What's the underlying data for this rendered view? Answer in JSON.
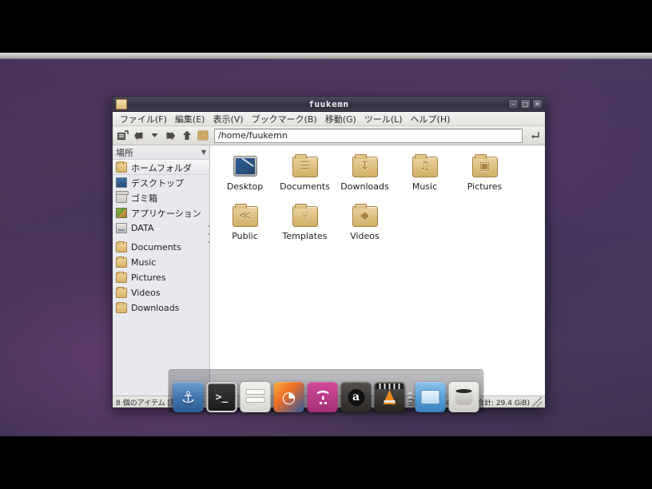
{
  "window": {
    "title": "fuukemn",
    "icon": "folder-icon",
    "buttons": [
      {
        "name": "minimize-button",
        "label": "–"
      },
      {
        "name": "maximize-button",
        "label": "□"
      },
      {
        "name": "close-button",
        "label": "✕"
      }
    ]
  },
  "menubar": {
    "items": [
      {
        "name": "menu-file",
        "label": "ファイル(F)"
      },
      {
        "name": "menu-edit",
        "label": "編集(E)"
      },
      {
        "name": "menu-view",
        "label": "表示(V)"
      },
      {
        "name": "menu-bookmarks",
        "label": "ブックマーク(B)"
      },
      {
        "name": "menu-go",
        "label": "移動(G)"
      },
      {
        "name": "menu-tools",
        "label": "ツール(L)"
      },
      {
        "name": "menu-help",
        "label": "ヘルプ(H)"
      }
    ]
  },
  "toolbar": {
    "buttons": [
      {
        "name": "new-tab-icon",
        "glyph": "❐"
      },
      {
        "name": "back-icon",
        "glyph": "⬅"
      },
      {
        "name": "history-dropdown-icon",
        "glyph": "▾"
      },
      {
        "name": "forward-icon",
        "glyph": "➡"
      },
      {
        "name": "up-icon",
        "glyph": "⬆"
      },
      {
        "name": "home-icon",
        "glyph": "■"
      }
    ],
    "path_value": "/home/fuukemn",
    "path_placeholder": "/home/fuukemn",
    "go_glyph": "↵"
  },
  "sidebar": {
    "header": "場所",
    "header_caret": "▼",
    "items": [
      {
        "name": "sidebar-item-home",
        "label": "ホームフォルダ",
        "icon": "ic-folder",
        "selected": true
      },
      {
        "name": "sidebar-item-desktop",
        "label": "デスクトップ",
        "icon": "ic-desktop",
        "selected": false
      },
      {
        "name": "sidebar-item-trash",
        "label": "ゴミ箱",
        "icon": "ic-trash",
        "selected": false
      },
      {
        "name": "sidebar-item-applications",
        "label": "アプリケーション",
        "icon": "ic-apps",
        "selected": false
      },
      {
        "name": "sidebar-item-data",
        "label": "DATA",
        "icon": "ic-drive",
        "selected": false
      },
      {
        "name": "sidebar-item-documents",
        "label": "Documents",
        "icon": "ic-folder",
        "selected": false,
        "gap_before": true
      },
      {
        "name": "sidebar-item-music",
        "label": "Music",
        "icon": "ic-folder",
        "selected": false
      },
      {
        "name": "sidebar-item-pictures",
        "label": "Pictures",
        "icon": "ic-folder",
        "selected": false
      },
      {
        "name": "sidebar-item-videos",
        "label": "Videos",
        "icon": "ic-folder",
        "selected": false
      },
      {
        "name": "sidebar-item-downloads",
        "label": "Downloads",
        "icon": "ic-folder",
        "selected": false
      }
    ]
  },
  "files": [
    {
      "name": "file-item-desktop",
      "label": "Desktop",
      "icon": "desktop-monitor-icon",
      "glyph": ""
    },
    {
      "name": "file-item-documents",
      "label": "Documents",
      "icon": "folder-documents-icon",
      "glyph": "☰"
    },
    {
      "name": "file-item-downloads",
      "label": "Downloads",
      "icon": "folder-downloads-icon",
      "glyph": "↧"
    },
    {
      "name": "file-item-music",
      "label": "Music",
      "icon": "folder-music-icon",
      "glyph": "♫"
    },
    {
      "name": "file-item-pictures",
      "label": "Pictures",
      "icon": "folder-pictures-icon",
      "glyph": "▣"
    },
    {
      "name": "file-item-public",
      "label": "Public",
      "icon": "folder-public-icon",
      "glyph": "≪"
    },
    {
      "name": "file-item-templates",
      "label": "Templates",
      "icon": "folder-templates-icon",
      "glyph": "⑂"
    },
    {
      "name": "file-item-videos",
      "label": "Videos",
      "icon": "folder-videos-icon",
      "glyph": "◆"
    }
  ],
  "statusbar": {
    "left": "8 個のアイテム [隠しアイテム 21個]",
    "right": "空き容量: 24.4 GiB (合計: 29.4 GiB)"
  },
  "dock": {
    "items": [
      {
        "name": "dock-item-docky",
        "cls": "d-docky",
        "glyph": "⚓"
      },
      {
        "name": "dock-item-terminal",
        "cls": "d-term",
        "glyph": ">_"
      },
      {
        "name": "dock-item-files",
        "cls": "d-files",
        "glyph": ""
      },
      {
        "name": "dock-item-firefox",
        "cls": "d-firefox",
        "glyph": "◔"
      },
      {
        "name": "dock-item-messaging",
        "cls": "d-chat",
        "glyph": ":-)"
      },
      {
        "name": "dock-item-amazon",
        "cls": "d-amazon",
        "glyph": "a"
      },
      {
        "name": "dock-item-vlc",
        "cls": "d-vlc",
        "glyph": ""
      },
      {
        "name": "dock-item-display",
        "cls": "d-display",
        "glyph": ""
      },
      {
        "name": "dock-item-trash",
        "cls": "d-trash",
        "glyph": ""
      }
    ],
    "separator_after_index": 6
  },
  "colors": {
    "desktop_purple": "#4b3560",
    "titlebar_dark": "#3b394a",
    "folder_tan": "#e2c488",
    "sidebar_bg": "#e8e9ef",
    "accent_blue": "#3f72ac"
  }
}
